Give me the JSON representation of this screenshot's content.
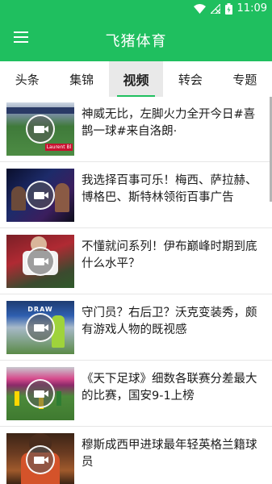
{
  "status": {
    "time": "11:09"
  },
  "appbar": {
    "title": "飞猪体育"
  },
  "tabs": [
    {
      "label": "头条"
    },
    {
      "label": "集锦"
    },
    {
      "label": "视频",
      "active": true
    },
    {
      "label": "转会"
    },
    {
      "label": "专题"
    }
  ],
  "items": [
    {
      "title": "神威无比，左脚火力全开今日#喜鹊一球#来自洛朗·",
      "thumb_overlay": "Laurent Bl"
    },
    {
      "title": "我选择百事可乐！梅西、萨拉赫、博格巴、斯特林领衔百事广告"
    },
    {
      "title": "不懂就问系列！伊布巅峰时期到底什么水平？"
    },
    {
      "title": "守门员？右后卫？沃克变装秀，颇有游戏人物的既视感",
      "thumb_overlay": "DRAW"
    },
    {
      "title": "《天下足球》细数各联赛分差最大的比赛，国安9-1上榜"
    },
    {
      "title": "穆斯成西甲进球最年轻英格兰籍球员"
    }
  ],
  "colors": {
    "brand": "#1fbf5f"
  }
}
